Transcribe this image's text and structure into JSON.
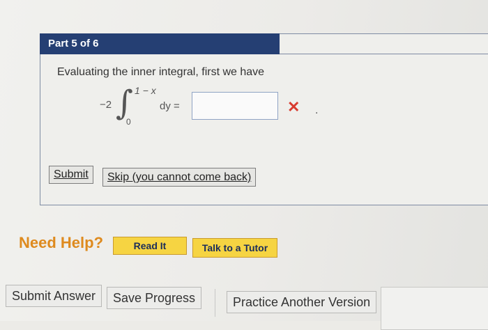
{
  "part": {
    "label": "Part 5 of 6"
  },
  "question": {
    "prompt": "Evaluating the inner integral, first we have",
    "coefficient": "−2",
    "upper_limit": "1 − x",
    "lower_limit": "0",
    "differential": "dy =",
    "answer_value": "",
    "status": "incorrect",
    "trailing": "."
  },
  "actions": {
    "submit": "Submit",
    "skip": "Skip (you cannot come back)"
  },
  "help": {
    "title": "Need Help?",
    "read_it": "Read It",
    "talk_to_tutor": "Talk to a Tutor"
  },
  "footer": {
    "submit_answer": "Submit Answer",
    "save_progress": "Save Progress",
    "practice": "Practice Another Version"
  },
  "colors": {
    "header": "#253f73",
    "help_title": "#de8a1e",
    "help_button": "#f6d442",
    "error": "#d83b2f"
  }
}
